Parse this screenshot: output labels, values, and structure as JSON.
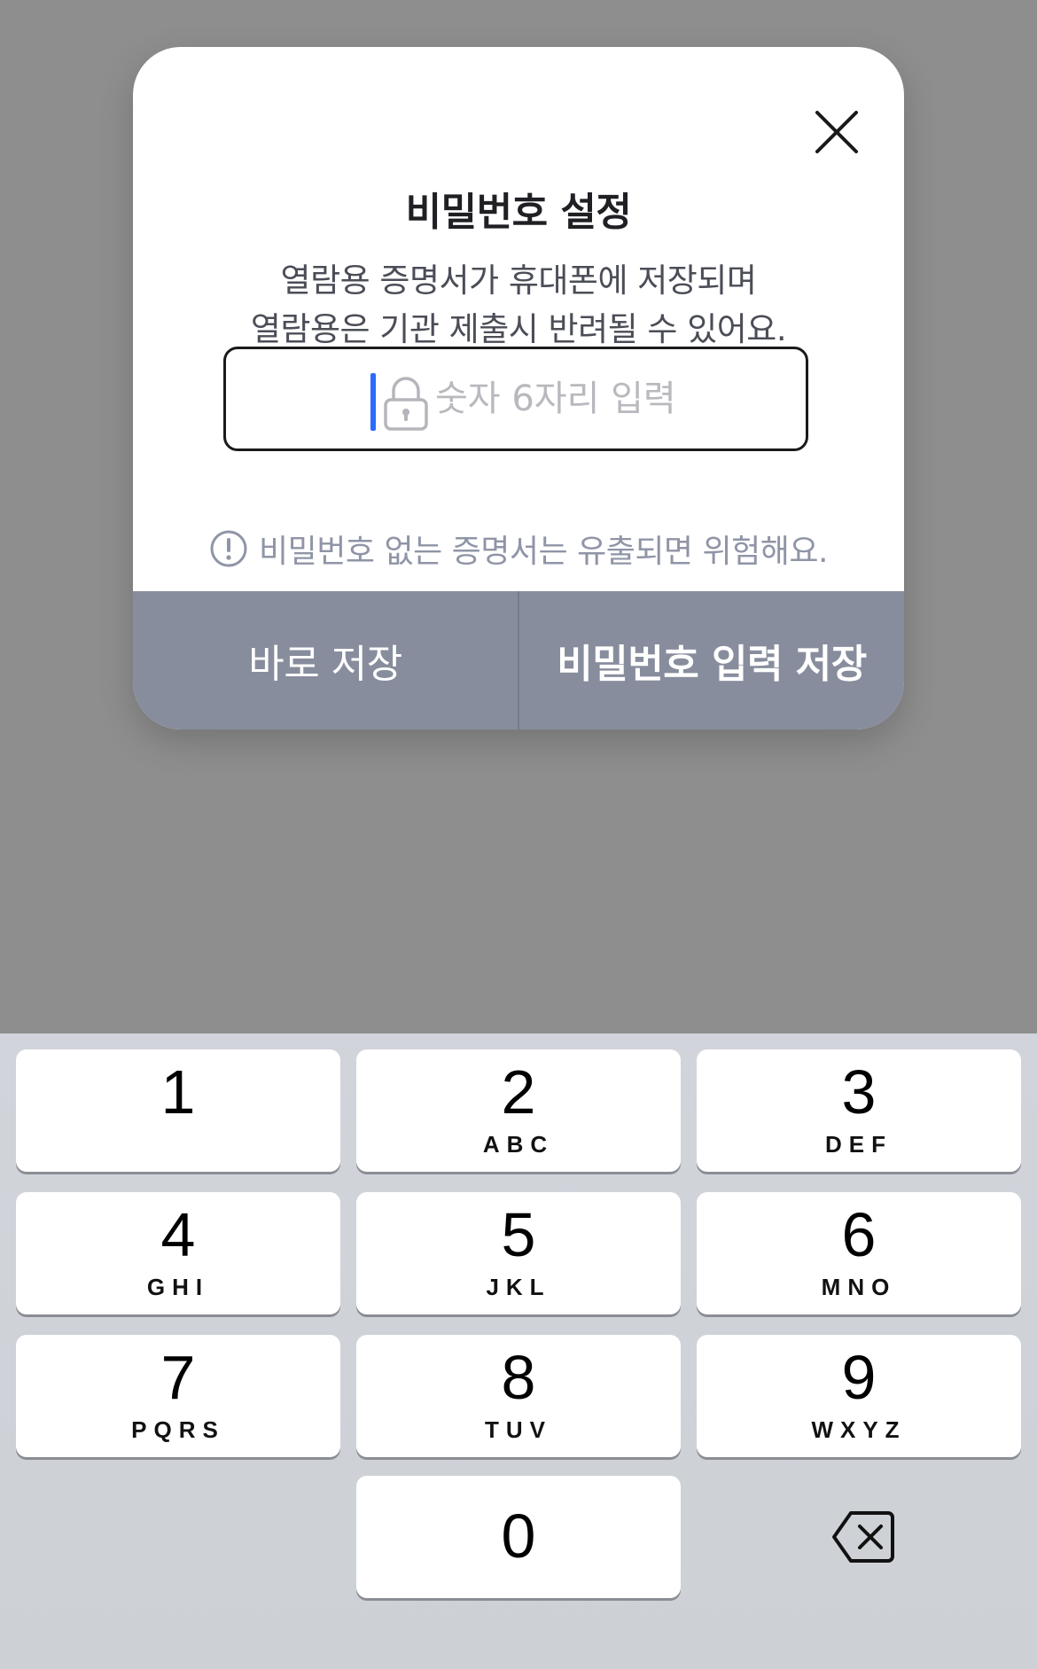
{
  "dialog": {
    "title": "비밀번호 설정",
    "description_lines": [
      "열람용 증명서가 휴대폰에 저장되며",
      "열람용은 기관 제출시 반려될 수 있어요."
    ],
    "password_field": {
      "placeholder": "숫자 6자리 입력",
      "value": ""
    },
    "warning": "비밀번호 없는 증명서는 유출되면 위험해요.",
    "buttons": {
      "save_now": "바로 저장",
      "save_with_password": "비밀번호 입력 저장"
    },
    "close_icon": "close-icon",
    "lock_icon": "lock-icon",
    "warning_icon": "exclamation-circle-icon"
  },
  "keypad": {
    "keys": [
      {
        "num": "1",
        "letters": ""
      },
      {
        "num": "2",
        "letters": "ABC"
      },
      {
        "num": "3",
        "letters": "DEF"
      },
      {
        "num": "4",
        "letters": "GHI"
      },
      {
        "num": "5",
        "letters": "JKL"
      },
      {
        "num": "6",
        "letters": "MNO"
      },
      {
        "num": "7",
        "letters": "PQRS"
      },
      {
        "num": "8",
        "letters": "TUV"
      },
      {
        "num": "9",
        "letters": "WXYZ"
      },
      {
        "num": "0",
        "letters": ""
      }
    ],
    "backspace_icon": "backspace-icon"
  },
  "colors": {
    "overlay": "#8e8e8e",
    "button_bar": "#878d9c",
    "caret": "#2d6bff",
    "warning_text": "#8f95a6",
    "keyboard_bg": "#d1d4da"
  }
}
